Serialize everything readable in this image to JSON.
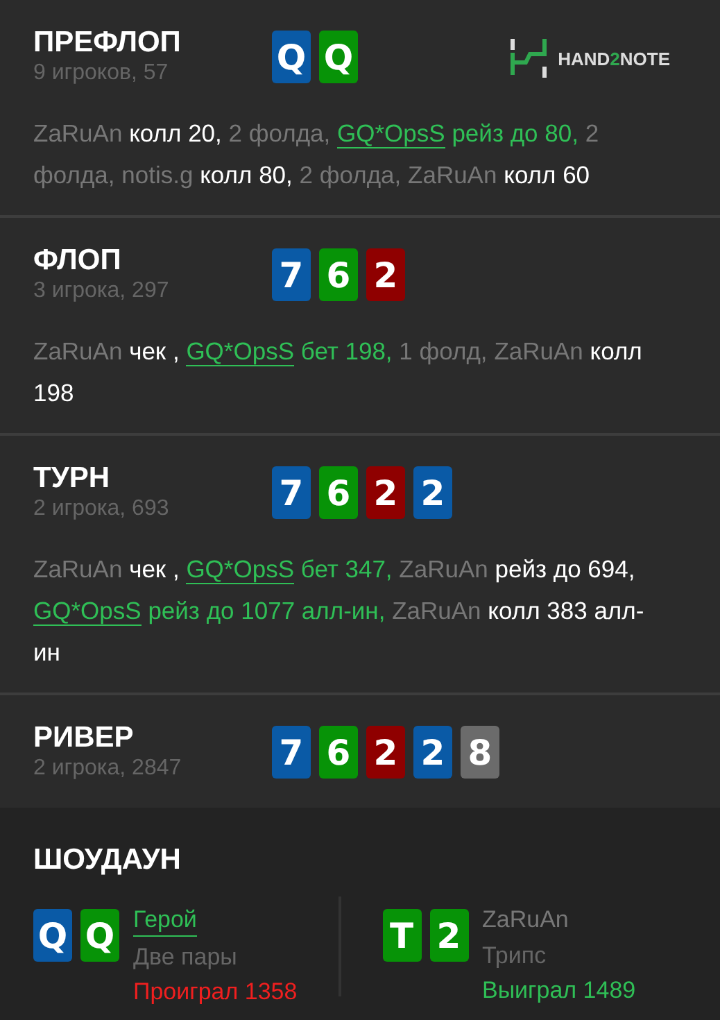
{
  "logo": [
    {
      "text": "HAND",
      "accent": false
    },
    {
      "text": "2",
      "accent": true
    },
    {
      "text": "NOTE",
      "accent": false
    }
  ],
  "streets": [
    {
      "title": "ПРЕФЛОП",
      "info": "9 игроков, 57",
      "cards": [
        {
          "rank": "Q",
          "color": "#0a5aa6"
        },
        {
          "rank": "Q",
          "color": "#079307"
        }
      ],
      "log": [
        {
          "kind": "player",
          "text": "ZaRuAn"
        },
        {
          "kind": "action",
          "text": "колл 20,"
        },
        {
          "kind": "note",
          "text": "2 фолда,"
        },
        {
          "kind": "hero",
          "text": "GQ*OpsS"
        },
        {
          "kind": "hero_action",
          "text": "рейз до 80,"
        },
        {
          "kind": "note",
          "text": "2 фолда,"
        },
        {
          "kind": "player",
          "text": "notis.g"
        },
        {
          "kind": "action",
          "text": "колл 80,"
        },
        {
          "kind": "note",
          "text": "2 фолда,"
        },
        {
          "kind": "player",
          "text": "ZaRuAn"
        },
        {
          "kind": "action",
          "text": "колл 60"
        }
      ]
    },
    {
      "title": "ФЛОП",
      "info": "3 игрока, 297",
      "cards": [
        {
          "rank": "7",
          "color": "#0a5aa6"
        },
        {
          "rank": "6",
          "color": "#079307"
        },
        {
          "rank": "2",
          "color": "#8f0000"
        }
      ],
      "log": [
        {
          "kind": "player",
          "text": "ZaRuAn"
        },
        {
          "kind": "action",
          "text": "чек ,"
        },
        {
          "kind": "hero",
          "text": "GQ*OpsS"
        },
        {
          "kind": "hero_action",
          "text": "бет 198,"
        },
        {
          "kind": "note",
          "text": "1 фолд,"
        },
        {
          "kind": "player",
          "text": "ZaRuAn"
        },
        {
          "kind": "action",
          "text": "колл 198"
        }
      ]
    },
    {
      "title": "ТУРН",
      "info": "2 игрока, 693",
      "cards": [
        {
          "rank": "7",
          "color": "#0a5aa6"
        },
        {
          "rank": "6",
          "color": "#079307"
        },
        {
          "rank": "2",
          "color": "#8f0000"
        },
        {
          "rank": "2",
          "color": "#0a5aa6"
        }
      ],
      "log": [
        {
          "kind": "player",
          "text": "ZaRuAn"
        },
        {
          "kind": "action",
          "text": "чек ,"
        },
        {
          "kind": "hero",
          "text": "GQ*OpsS"
        },
        {
          "kind": "hero_action",
          "text": "бет 347,"
        },
        {
          "kind": "player",
          "text": "ZaRuAn"
        },
        {
          "kind": "action",
          "text": "рейз до 694,"
        },
        {
          "kind": "hero",
          "text": "GQ*OpsS"
        },
        {
          "kind": "hero_action",
          "text": "рейз до 1077 алл-ин,"
        },
        {
          "kind": "player",
          "text": "ZaRuAn"
        },
        {
          "kind": "action",
          "text": "колл 383 алл-ин"
        }
      ]
    },
    {
      "title": "РИВЕР",
      "info": "2 игрока, 2847",
      "cards": [
        {
          "rank": "7",
          "color": "#0a5aa6"
        },
        {
          "rank": "6",
          "color": "#079307"
        },
        {
          "rank": "2",
          "color": "#8f0000"
        },
        {
          "rank": "2",
          "color": "#0a5aa6"
        },
        {
          "rank": "8",
          "color": "#6b6b6b"
        }
      ]
    }
  ],
  "showdown": {
    "title": "ШОУДАУН",
    "players": [
      {
        "name": "Герой",
        "hero": true,
        "hand": "Две пары",
        "result": "Проиграл 1358",
        "won": false,
        "cards": [
          {
            "rank": "Q",
            "color": "#0a5aa6"
          },
          {
            "rank": "Q",
            "color": "#079307"
          }
        ]
      },
      {
        "name": "ZaRuAn",
        "hero": false,
        "hand": "Трипс",
        "result": "Выиграл 1489",
        "won": true,
        "cards": [
          {
            "rank": "T",
            "color": "#079307"
          },
          {
            "rank": "2",
            "color": "#079307"
          }
        ]
      }
    ]
  }
}
